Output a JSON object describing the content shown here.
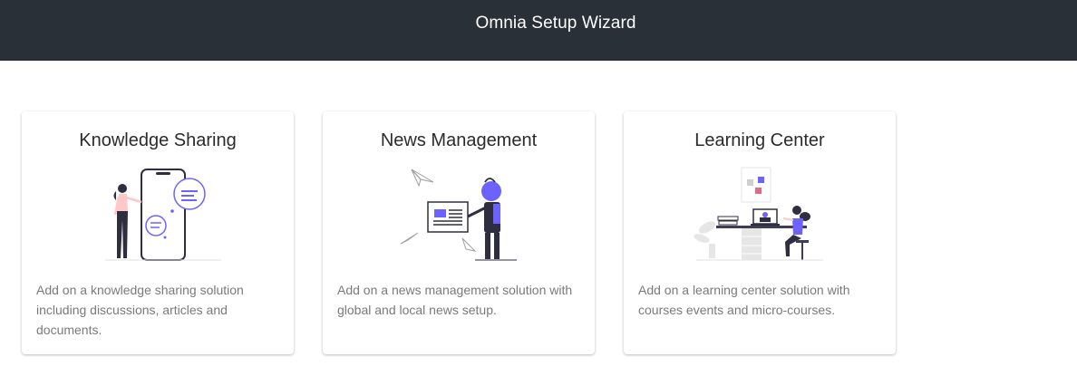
{
  "header": {
    "title": "Omnia Setup Wizard"
  },
  "cards": [
    {
      "title": "Knowledge Sharing",
      "description": "Add on a knowledge sharing solution including discussions, articles and documents.",
      "illustration": "knowledge-sharing-illustration"
    },
    {
      "title": "News Management",
      "description": "Add on a news management solution with global and local news setup.",
      "illustration": "news-management-illustration"
    },
    {
      "title": "Learning Center",
      "description": "Add on a learning center solution with courses events and micro-courses.",
      "illustration": "learning-center-illustration"
    }
  ],
  "colors": {
    "header_bg": "#2a3038",
    "accent": "#6c63ff",
    "dark": "#2f2e41",
    "text_muted": "#7a7a7a"
  }
}
